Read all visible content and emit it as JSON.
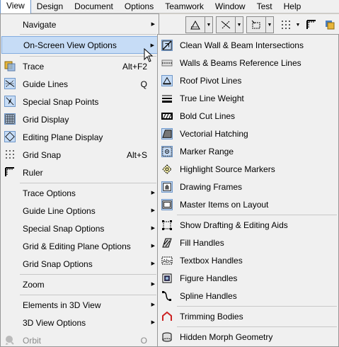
{
  "menubar": {
    "items": [
      "View",
      "Design",
      "Document",
      "Options",
      "Teamwork",
      "Window",
      "Test",
      "Help"
    ],
    "active": "View"
  },
  "toolbar": {
    "icons": [
      "roof-pivot-lines-icon",
      "guide-lines-icon",
      "section-marker-icon",
      "grid-snap-icon",
      "ruler-icon",
      "layers-icon"
    ]
  },
  "view_menu": {
    "items": [
      {
        "label": "Navigate",
        "submenu": true
      },
      {
        "label": "On-Screen View Options",
        "submenu": true,
        "highlighted": true
      },
      {
        "label": "Trace",
        "shortcut": "Alt+F2",
        "icon": "trace-icon"
      },
      {
        "label": "Guide Lines",
        "shortcut": "Q",
        "icon": "guide-lines-icon",
        "checked": true
      },
      {
        "label": "Special Snap Points",
        "icon": "special-snap-icon",
        "checked": true
      },
      {
        "label": "Grid Display",
        "icon": "grid-display-icon",
        "checked": true
      },
      {
        "label": "Editing Plane Display",
        "icon": "editing-plane-icon",
        "checked": true
      },
      {
        "label": "Grid Snap",
        "shortcut": "Alt+S",
        "icon": "grid-snap-icon"
      },
      {
        "label": "Ruler",
        "icon": "ruler-icon"
      },
      {
        "label": "Trace Options",
        "submenu": true
      },
      {
        "label": "Guide Line Options",
        "submenu": true
      },
      {
        "label": "Special Snap Options",
        "submenu": true
      },
      {
        "label": "Grid & Editing Plane Options",
        "submenu": true
      },
      {
        "label": "Grid Snap Options",
        "submenu": true
      },
      {
        "label": "Zoom",
        "submenu": true
      },
      {
        "label": "Elements in 3D View",
        "submenu": true
      },
      {
        "label": "3D View Options",
        "submenu": true
      },
      {
        "label": "Orbit",
        "shortcut": "O",
        "icon": "orbit-icon",
        "disabled": true
      }
    ]
  },
  "submenu": {
    "items": [
      {
        "label": "Clean Wall & Beam Intersections",
        "icon": "clean-intersections-icon",
        "checked": true
      },
      {
        "label": "Walls & Beams Reference Lines",
        "icon": "reference-lines-icon"
      },
      {
        "label": "Roof Pivot Lines",
        "icon": "roof-pivot-icon",
        "checked": true
      },
      {
        "label": "True Line Weight",
        "icon": "line-weight-icon"
      },
      {
        "label": "Bold Cut Lines",
        "icon": "bold-cut-lines-icon"
      },
      {
        "label": "Vectorial Hatching",
        "icon": "vectorial-hatching-icon",
        "checked": true
      },
      {
        "label": "Marker Range",
        "icon": "marker-range-icon",
        "checked": true
      },
      {
        "label": "Highlight Source Markers",
        "icon": "source-markers-icon"
      },
      {
        "label": "Drawing Frames",
        "icon": "drawing-frames-icon",
        "checked": true
      },
      {
        "label": "Master Items on Layout",
        "icon": "master-items-icon",
        "checked": true
      },
      {
        "label": "Show Drafting & Editing Aids",
        "icon": "drafting-aids-icon"
      },
      {
        "label": "Fill Handles",
        "icon": "fill-handles-icon"
      },
      {
        "label": "Textbox Handles",
        "icon": "textbox-handles-icon"
      },
      {
        "label": "Figure Handles",
        "icon": "figure-handles-icon"
      },
      {
        "label": "Spline Handles",
        "icon": "spline-handles-icon"
      },
      {
        "label": "Trimming Bodies",
        "icon": "trimming-bodies-icon"
      },
      {
        "label": "Hidden Morph Geometry",
        "icon": "morph-geometry-icon"
      }
    ]
  },
  "colors": {
    "menu_bg": "#f0f0f0",
    "highlight": "#c6dcf6",
    "highlight_border": "#83ace0",
    "check_border": "#6f97c9",
    "trimming_red": "#cc2222"
  }
}
